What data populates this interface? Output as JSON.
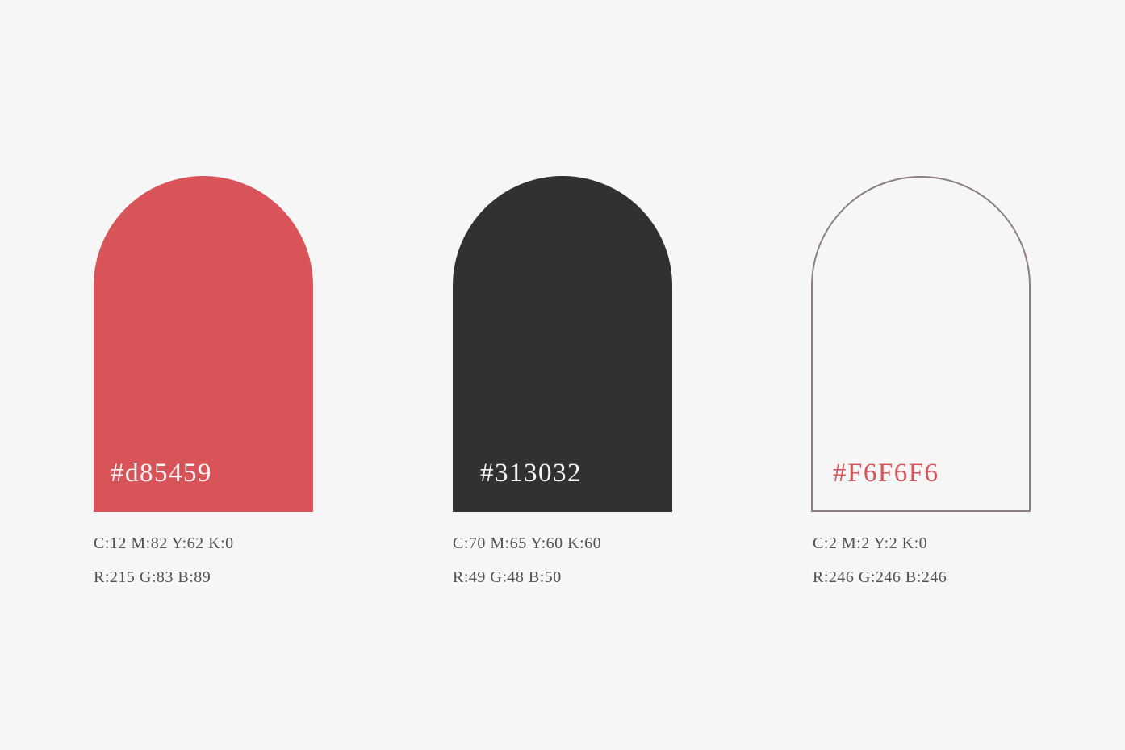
{
  "palette": [
    {
      "hex": "#d85459",
      "cmyk": "C:12 M:82 Y:62 K:0",
      "rgb": "R:215 G:83 B:89",
      "fill": "#d85459",
      "label_color": "#f6f6f6",
      "outline": ""
    },
    {
      "hex": "#313032",
      "cmyk": "C:70 M:65 Y:60 K:60",
      "rgb": "R:49 G:48 B:50",
      "fill": "#313032",
      "label_color": "#f6f6f6",
      "outline": ""
    },
    {
      "hex": "#F6F6F6",
      "cmyk": "C:2 M:2 Y:2 K:0",
      "rgb": "R:246 G:246 B:246",
      "fill": "#f6f6f6",
      "label_color": "#d85459",
      "outline": "#8c7f82"
    }
  ]
}
